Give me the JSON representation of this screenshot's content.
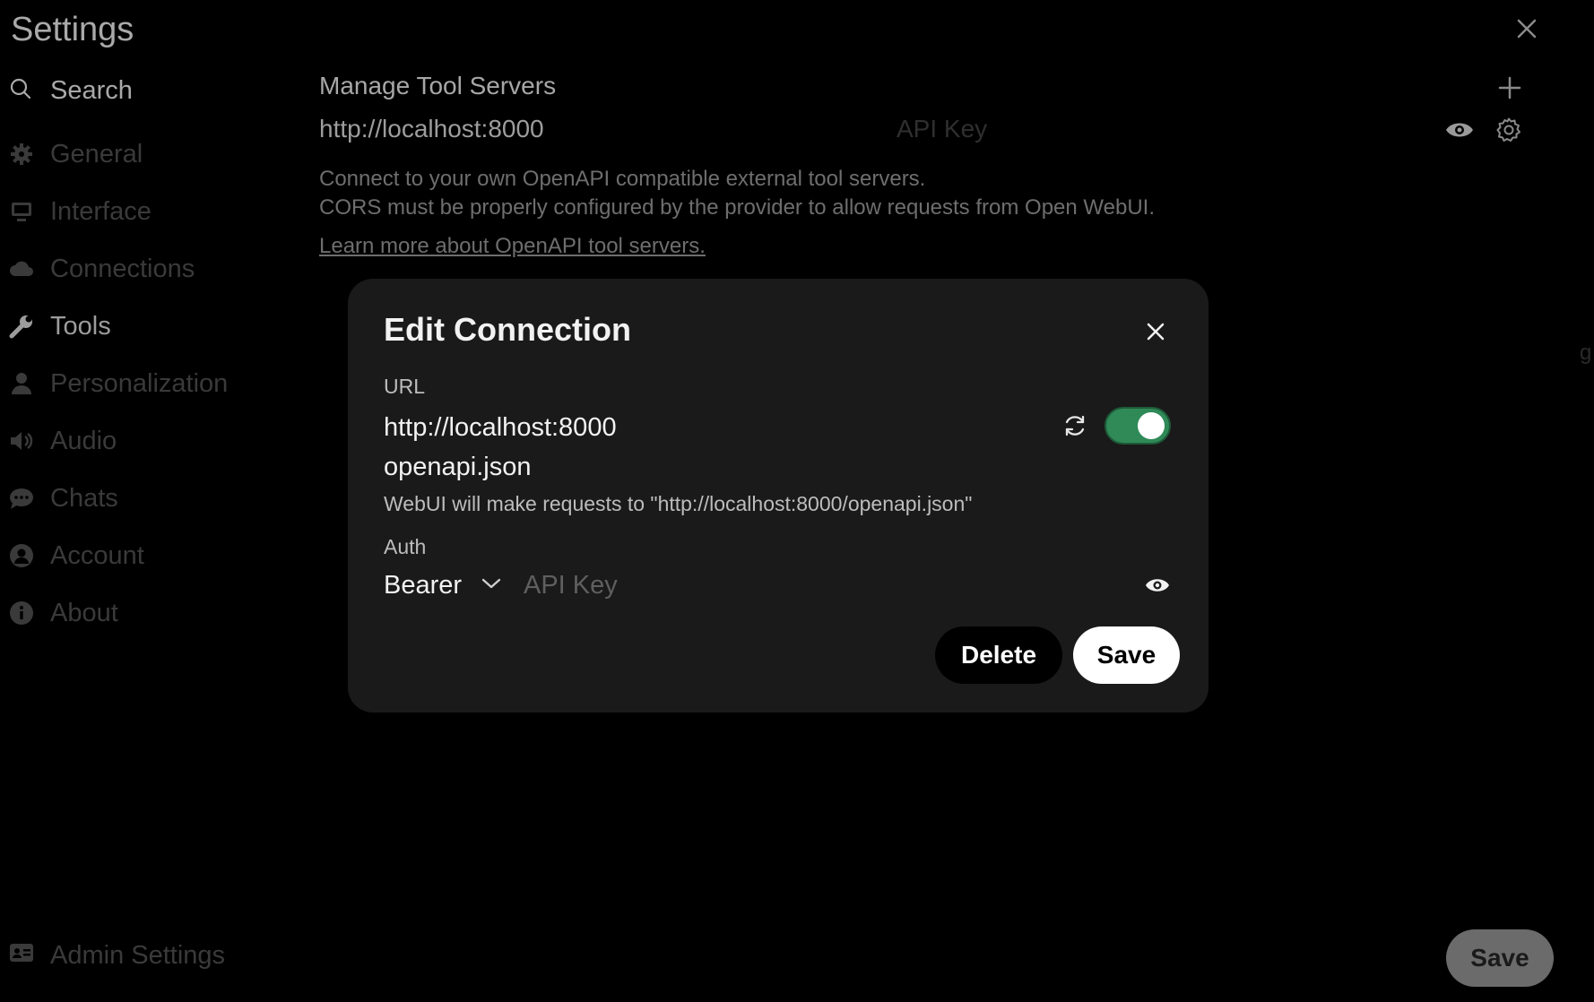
{
  "settings": {
    "title": "Settings",
    "search_label": "Search",
    "nav_items": [
      {
        "label": "General",
        "icon": "gear-icon"
      },
      {
        "label": "Interface",
        "icon": "monitor-icon"
      },
      {
        "label": "Connections",
        "icon": "cloud-icon"
      },
      {
        "label": "Tools",
        "icon": "wrench-icon",
        "active": true
      },
      {
        "label": "Personalization",
        "icon": "user-icon"
      },
      {
        "label": "Audio",
        "icon": "speaker-icon"
      },
      {
        "label": "Chats",
        "icon": "chat-bubble-icon"
      },
      {
        "label": "Account",
        "icon": "user-circle-icon"
      },
      {
        "label": "About",
        "icon": "info-icon"
      }
    ],
    "admin_label": "Admin Settings",
    "save_label": "Save"
  },
  "tools_panel": {
    "title": "Manage Tool Servers",
    "server_url": "http://localhost:8000",
    "api_key_placeholder": "API Key",
    "description_line1": "Connect to your own OpenAPI compatible external tool servers.",
    "description_line2": "CORS must be properly configured by the provider to allow requests from Open WebUI.",
    "learn_more": "Learn more about OpenAPI tool servers.",
    "stray_text": "g"
  },
  "modal": {
    "title": "Edit Connection",
    "url_label": "URL",
    "url_value": "http://localhost:8000",
    "path_value": "openapi.json",
    "enabled": true,
    "hint": "WebUI will make requests to \"http://localhost:8000/openapi.json\"",
    "auth_label": "Auth",
    "auth_type": "Bearer",
    "api_key_placeholder": "API Key",
    "delete_label": "Delete",
    "save_label": "Save"
  },
  "colors": {
    "toggle_on": "#2f8a57",
    "modal_bg": "#1a1a1a",
    "page_bg": "#000000"
  }
}
